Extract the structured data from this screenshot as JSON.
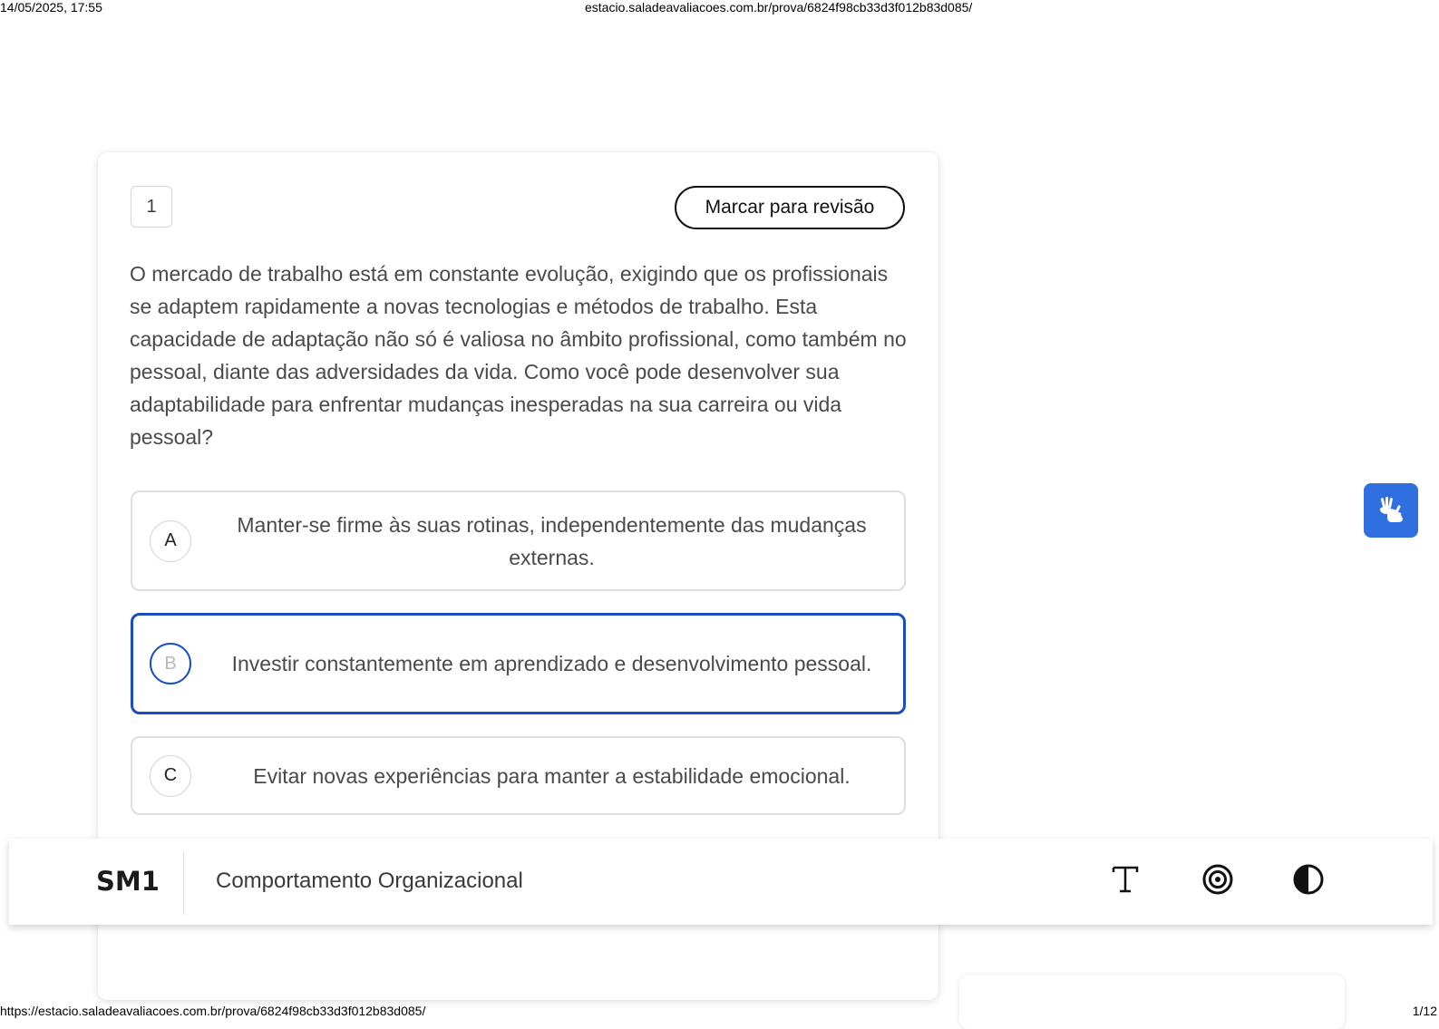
{
  "print_header": {
    "datetime": "14/05/2025, 17:55",
    "url": "estacio.saladeavaliacoes.com.br/prova/6824f98cb33d3f012b83d085/"
  },
  "print_footer": {
    "url": "https://estacio.saladeavaliacoes.com.br/prova/6824f98cb33d3f012b83d085/",
    "page": "1/12"
  },
  "question": {
    "number": "1",
    "review_label": "Marcar para revisão",
    "text": "O mercado de trabalho está em constante evolução, exigindo que os profissionais se adaptem rapidamente a novas tecnologias e métodos de trabalho. Esta capacidade de adaptação não só é valiosa no âmbito profissional, como também no pessoal, diante das adversidades da vida. Como você pode desenvolver sua adaptabilidade para enfrentar mudanças inesperadas na sua carreira ou vida pessoal?",
    "selected": "B",
    "options": [
      {
        "letter": "A",
        "text": "Manter-se firme às suas rotinas, independentemente das mudanças externas."
      },
      {
        "letter": "B",
        "text": "Investir constantemente em aprendizado e desenvolvimento pessoal."
      },
      {
        "letter": "C",
        "text": "Evitar novas experiências para manter a estabilidade emocional."
      }
    ]
  },
  "bottom_bar": {
    "code": "SM1",
    "course": "Comportamento Organizacional",
    "tools": [
      "font-size-icon",
      "target-icon",
      "contrast-icon"
    ]
  },
  "colors": {
    "selected_border": "#1a4ec0",
    "libras_button": "#2f6fe0"
  }
}
